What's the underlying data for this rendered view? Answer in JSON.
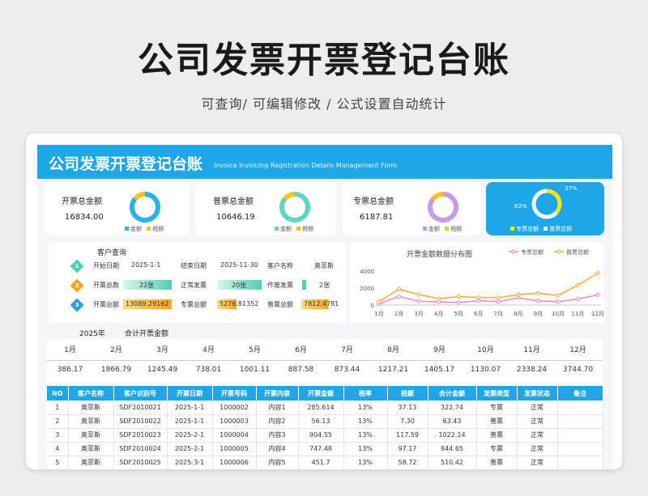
{
  "page": {
    "title": "公司发票开票登记台账",
    "subtitle": "可查询/  可编辑修改  /  公式设置自动统计"
  },
  "header": {
    "title": "公司发票开票登记台账",
    "english": "Invoice Invoicing Registration Details Management Form"
  },
  "cards": [
    {
      "label": "开票总金额",
      "value": "16834.00",
      "legend": [
        "金额",
        "税额"
      ],
      "colors": [
        "#2ab3e8",
        "#f5c518"
      ],
      "share": 0.86
    },
    {
      "label": "普票总金额",
      "value": "10646.19",
      "legend": [
        "金额",
        "税额"
      ],
      "colors": [
        "#5fd6c4",
        "#f5c518"
      ],
      "share": 0.86
    },
    {
      "label": "专票总金额",
      "value": "6187.81",
      "legend": [
        "金额",
        "税额"
      ],
      "colors": [
        "#c79be6",
        "#f5c518"
      ],
      "share": 0.86
    }
  ],
  "ratio_card": {
    "pct_special": "37%",
    "pct_normal": "63%",
    "legend": [
      "专票总额",
      "普票总额"
    ],
    "colors": [
      "#f5e616",
      "#ffffff"
    ],
    "share_special": 0.37
  },
  "query": {
    "title": "客户查询",
    "rows": [
      {
        "num": "1",
        "badge_color": "#4fcfb8",
        "c1_label": "开始日期",
        "c1_value": "2025-1-1",
        "c2_label": "结束日期",
        "c2_value": "2025-11-30",
        "c3_label": "客户名称",
        "c3_value": "奥菲斯"
      },
      {
        "num": "2",
        "badge_color": "#f5a623",
        "c1_label": "开票总数",
        "c1_value": "22张",
        "c2_label": "正常发票",
        "c2_value": "20张",
        "c3_label": "作废发票",
        "c3_value": "2张"
      },
      {
        "num": "3",
        "badge_color": "#2a9fd6",
        "c1_label": "开票总额",
        "c1_value": "13089.29162",
        "c2_label": "专票总额",
        "c2_value": "5276.81352",
        "c3_label": "普票总额",
        "c3_value": "7812.4781"
      }
    ],
    "fills": {
      "total_count": 1.0,
      "normal_count": 0.91,
      "void_count": 0.09,
      "total_amount": 1.0,
      "special_amount": 0.4,
      "normal_amount": 0.6
    }
  },
  "chart_data": {
    "type": "line",
    "title": "开票金额数据分布图",
    "categories": [
      "1月",
      "2月",
      "3月",
      "4月",
      "5月",
      "6月",
      "7月",
      "8月",
      "9月",
      "10月",
      "11月",
      "12月"
    ],
    "series": [
      {
        "name": "专票总额",
        "color": "#ee82c8",
        "values": [
          150,
          1000,
          450,
          380,
          300,
          500,
          400,
          850,
          500,
          400,
          700,
          1200
        ]
      },
      {
        "name": "普票总额",
        "color": "#f5a623",
        "values": [
          386,
          1866,
          1245,
          738,
          1001,
          887,
          873,
          1217,
          1405,
          1130,
          2338,
          3744
        ]
      }
    ],
    "ylim": [
      0,
      4000
    ],
    "yticks": [
      0,
      2000,
      4000
    ],
    "legend_position": "top-right",
    "grid": false
  },
  "monthly": {
    "year_label": "2025年",
    "total_label": "合计开票金额",
    "months": [
      "1月",
      "2月",
      "3月",
      "4月",
      "5月",
      "6月",
      "7月",
      "8月",
      "9月",
      "10月",
      "11月",
      "12月"
    ],
    "values": [
      "386.17",
      "1866.79",
      "1245.49",
      "738.01",
      "1001.11",
      "887.58",
      "873.44",
      "1217.21",
      "1405.17",
      "1130.07",
      "2338.24",
      "3744.70"
    ]
  },
  "table": {
    "columns": [
      "NO",
      "客户名称",
      "客户识别号",
      "开票日期",
      "开票号码",
      "开票内容",
      "开票金额",
      "税率",
      "税额",
      "合计金额",
      "发票类型",
      "发票状态",
      "备注"
    ],
    "rows": [
      [
        "1",
        "奥菲斯",
        "SDF2010021",
        "2025-1-1",
        "1000002",
        "内容1",
        "285.614",
        "13%",
        "37.13",
        "322.74",
        "专票",
        "正常",
        ""
      ],
      [
        "2",
        "奥菲斯",
        "SDF2010022",
        "2025-1-1",
        "1000003",
        "内容2",
        "56.13",
        "13%",
        "7.30",
        "63.43",
        "普票",
        "正常",
        ""
      ],
      [
        "3",
        "奥菲斯",
        "SDF2010023",
        "2025-2-1",
        "1000004",
        "内容3",
        "904.55",
        "13%",
        "117.59",
        "1022.14",
        "普票",
        "正常",
        ""
      ],
      [
        "4",
        "奥菲斯",
        "SDF2010024",
        "2025-2-1",
        "1000005",
        "内容4",
        "747.48",
        "13%",
        "97.17",
        "844.65",
        "专票",
        "正常",
        ""
      ],
      [
        "5",
        "奥菲斯",
        "SDF2010025",
        "2025-3-1",
        "1000006",
        "内容5",
        "451.7",
        "13%",
        "58.72",
        "510.42",
        "普票",
        "正常",
        ""
      ]
    ]
  }
}
